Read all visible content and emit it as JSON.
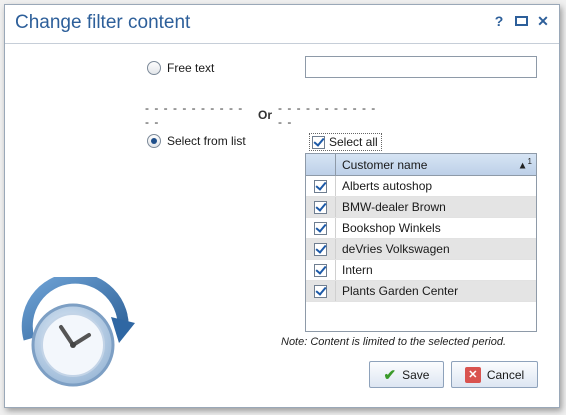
{
  "dialog": {
    "title": "Change filter content"
  },
  "title_icons": [
    "help-icon",
    "maximize-icon",
    "close-icon"
  ],
  "free_text": {
    "label": "Free text",
    "selected": false,
    "value": ""
  },
  "separator": {
    "text": "Or"
  },
  "select_from_list": {
    "label": "Select from list",
    "selected": true
  },
  "select_all": {
    "label": "Select all",
    "checked": true
  },
  "grid": {
    "header": "Customer name",
    "sort_indicator": "1",
    "rows": [
      {
        "name": "Alberts autoshop",
        "checked": true
      },
      {
        "name": "BMW-dealer Brown",
        "checked": true
      },
      {
        "name": "Bookshop Winkels",
        "checked": true
      },
      {
        "name": "deVries Volkswagen",
        "checked": true
      },
      {
        "name": "Intern",
        "checked": true
      },
      {
        "name": "Plants Garden Center",
        "checked": true
      }
    ]
  },
  "note": "Note: Content is limited to the selected period.",
  "buttons": {
    "save": "Save",
    "cancel": "Cancel"
  },
  "colors": {
    "title": "#2d5f9a",
    "header": "#c7d8ee",
    "save_icon": "#3a9a2a",
    "cancel_icon": "#d9534f"
  }
}
